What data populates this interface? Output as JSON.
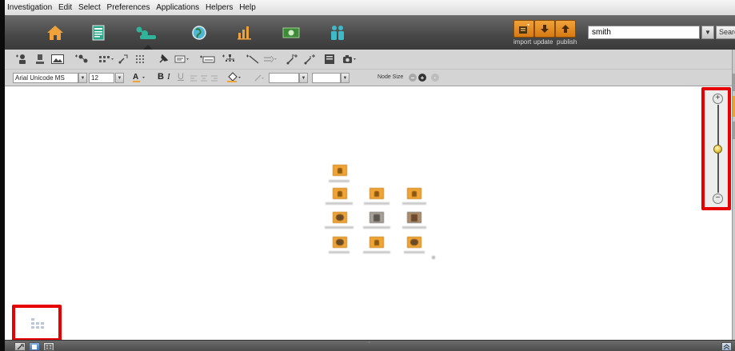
{
  "menu": {
    "items": [
      "Investigation",
      "Edit",
      "Select",
      "Preferences",
      "Applications",
      "Helpers",
      "Help"
    ]
  },
  "nav": {
    "icons": [
      "home-icon",
      "document-icon",
      "network-icon",
      "globe-icon",
      "chart-icon",
      "money-icon",
      "people-icon"
    ],
    "active": "network-icon",
    "import_label": "import",
    "update_label": "update",
    "publish_label": "publish"
  },
  "search": {
    "value": "smith",
    "button_label": "Search"
  },
  "toolbar": {
    "font_value": "Arial Unicode MS",
    "size_value": "12",
    "bold_label": "B",
    "italic_label": "I",
    "underline_label": "U",
    "node_size_label": "Node Size"
  },
  "zoom": {
    "level": 0.5
  },
  "colors": {
    "accent_orange": "#f2a535",
    "highlight_red": "#e60000",
    "navbar_dark": "#474747",
    "toolbar_gray": "#d4d4d4"
  }
}
